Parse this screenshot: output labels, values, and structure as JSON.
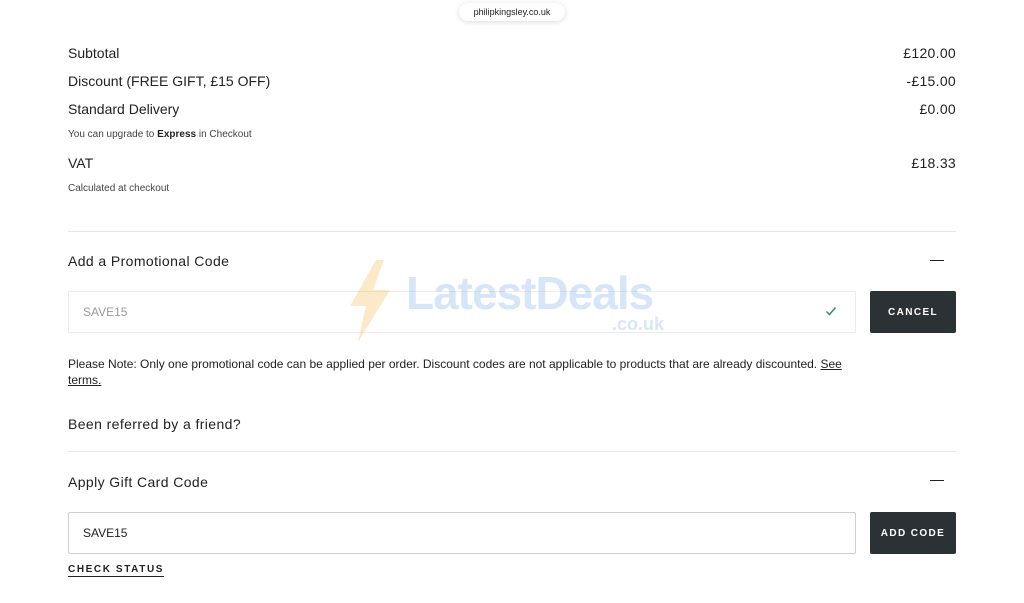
{
  "browser": {
    "url": "philipkingsley.co.uk"
  },
  "summary": {
    "subtotal": {
      "label": "Subtotal",
      "value": "£120.00"
    },
    "discount": {
      "label": "Discount (FREE GIFT, £15 OFF)",
      "value": "-£15.00"
    },
    "delivery": {
      "label": "Standard Delivery",
      "value": "£0.00"
    },
    "delivery_note_prefix": "You can upgrade to ",
    "delivery_note_bold": "Express",
    "delivery_note_suffix": " in Checkout",
    "vat": {
      "label": "VAT",
      "value": "£18.33"
    },
    "vat_note": "Calculated at checkout"
  },
  "promo": {
    "title": "Add a Promotional Code",
    "input_value": "SAVE15",
    "button_label": "CANCEL",
    "note_text": "Please Note: Only one promotional code can be applied per order. Discount codes are not applicable to products that are already discounted. ",
    "note_link": "See terms."
  },
  "referral": {
    "label": "Been referred by a friend?"
  },
  "gift_card": {
    "title": "Apply Gift Card Code",
    "input_value": "SAVE15",
    "button_label": "ADD CODE",
    "status_link": "CHECK STATUS"
  },
  "watermark": {
    "brand": "LatestDeals",
    "domain": ".co.uk"
  },
  "colors": {
    "button_bg": "#2b3235",
    "check": "#3a8a78",
    "watermark": "#6ea6e6"
  },
  "icons": {
    "promo_toggle": "minus-icon",
    "gift_toggle": "minus-icon",
    "applied": "check-icon"
  }
}
